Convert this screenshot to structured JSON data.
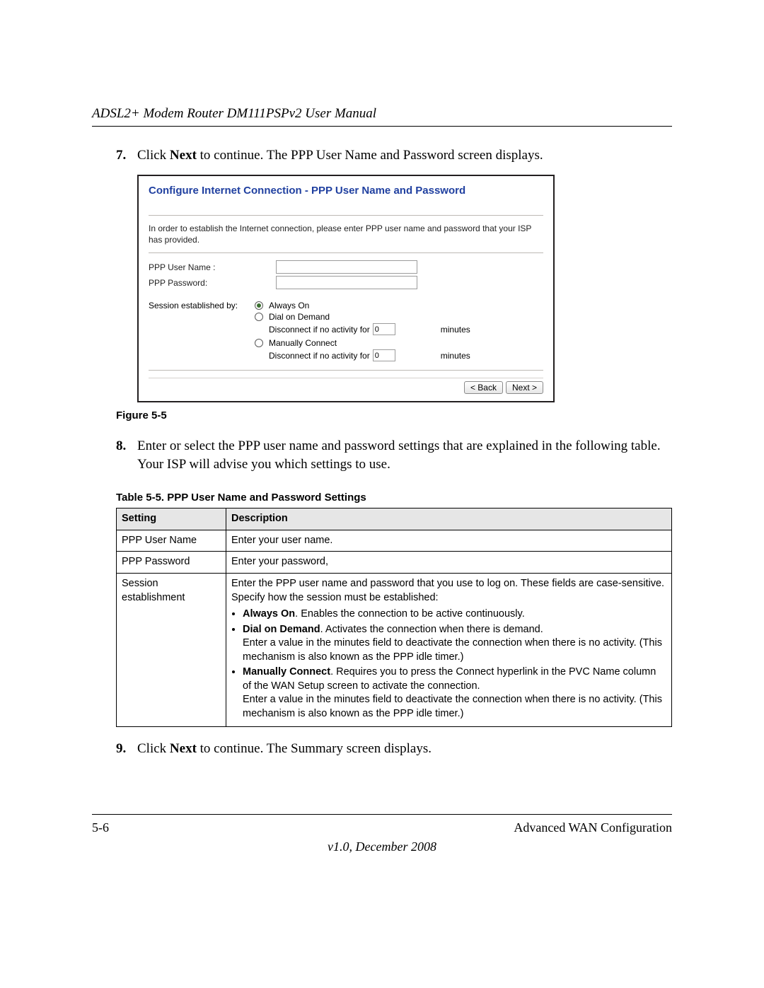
{
  "header": {
    "title": "ADSL2+ Modem Router DM111PSPv2 User Manual"
  },
  "steps": {
    "s7": {
      "num": "7.",
      "pre": "Click ",
      "bold": "Next",
      "post": " to continue. The PPP User Name and Password screen displays."
    },
    "s8": {
      "num": "8.",
      "text": "Enter or select the PPP user name and password settings that are explained in the following table. Your ISP will advise you which settings to use."
    },
    "s9": {
      "num": "9.",
      "pre": "Click ",
      "bold": "Next",
      "post": " to continue. The Summary screen displays."
    }
  },
  "screenshot": {
    "title": "Configure Internet Connection - PPP User Name and Password",
    "intro": "In order to establish the Internet connection, please enter PPP user name and password that your ISP has provided.",
    "labels": {
      "user": "PPP User Name :",
      "pass": "PPP Password:",
      "session": "Session established by:"
    },
    "opts": {
      "always": "Always On",
      "dial": "Dial on Demand",
      "disconnect": "Disconnect if no activity for",
      "minutes": "minutes",
      "manual": "Manually Connect"
    },
    "values": {
      "user": "",
      "pass": "",
      "idle1": "0",
      "idle2": "0"
    },
    "buttons": {
      "back": "< Back",
      "next": "Next >"
    }
  },
  "figure_caption": "Figure 5-5",
  "table_caption": "Table 5-5. PPP User Name and Password Settings",
  "table": {
    "head": {
      "c1": "Setting",
      "c2": "Description"
    },
    "rows": {
      "r1": {
        "c1": "PPP User Name",
        "c2": "Enter your user name."
      },
      "r2": {
        "c1": "PPP Password",
        "c2": "Enter your password,"
      },
      "r3": {
        "c1": "Session establishment",
        "intro": "Enter the PPP user name and password that you use to log on. These fields are case-sensitive. Specify how the session must be established:",
        "b1_bold": "Always On",
        "b1_rest": ". Enables the connection to be active continuously.",
        "b2_bold": "Dial on Demand",
        "b2_rest": ". Activates the connection when there is demand.",
        "b2_line2": "Enter a value in the minutes field to deactivate the connection when there is no activity. (This mechanism is also known as the PPP idle timer.)",
        "b3_bold": "Manually Connect",
        "b3_rest": ". Requires you to press the Connect hyperlink in the PVC Name column of the WAN Setup screen to activate the connection.",
        "b3_line2": "Enter a value in the minutes field to deactivate the connection when there is no activity. (This mechanism is also known as the PPP idle timer.)"
      }
    }
  },
  "footer": {
    "page": "5-6",
    "section": "Advanced WAN Configuration",
    "version": "v1.0, December 2008"
  }
}
